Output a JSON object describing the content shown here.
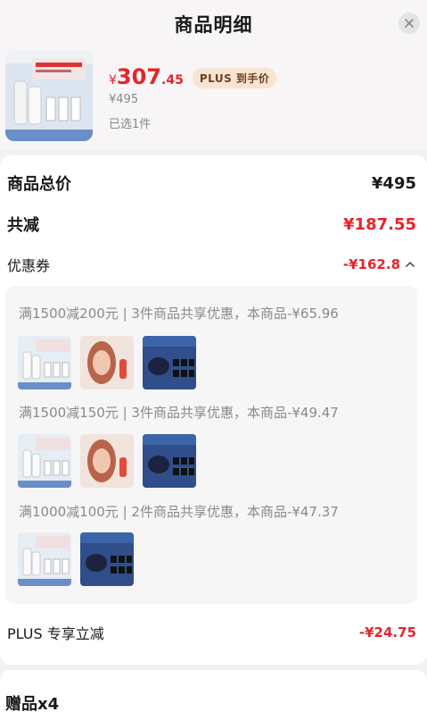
{
  "header": {
    "title": "商品明细"
  },
  "product": {
    "currency": "¥",
    "price_int": "307",
    "price_dec": ".45",
    "plus_badge": "PLUS 到手价",
    "original_price": "¥495",
    "selected": "已选1件"
  },
  "summary": {
    "total_label": "商品总价",
    "total_value": "¥495",
    "discount_label": "共减",
    "discount_value": "¥187.55",
    "coupon_label": "优惠券",
    "coupon_value": "-¥162.8",
    "plus_label": "PLUS 专享立减",
    "plus_value": "-¥24.75"
  },
  "coupons": [
    {
      "rule": "满1500减200元 | 3件商品共享优惠，本商品-¥65.96",
      "images": [
        "lancome-cream-box",
        "woman-portrait",
        "blue-jar-set"
      ]
    },
    {
      "rule": "满1500减150元 | 3件商品共享优惠，本商品-¥49.47",
      "images": [
        "lancome-cream-box",
        "woman-portrait",
        "blue-jar-set"
      ]
    },
    {
      "rule": "满1000减100元 | 2件商品共享优惠，本商品-¥47.37",
      "images": [
        "lancome-cream-box",
        "blue-jar-set"
      ]
    }
  ],
  "gifts": {
    "label": "赠品x4"
  },
  "colors": {
    "accent": "#e8232b",
    "plus_badge_bg": "#f7e4d3",
    "muted": "#8a8a8a"
  },
  "icons": {
    "close": "close-icon",
    "coupon_toggle": "chevron-up-icon"
  }
}
